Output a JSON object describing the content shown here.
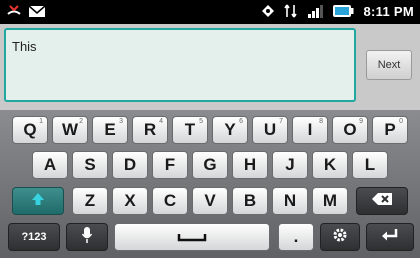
{
  "status_bar": {
    "time": "8:11 PM",
    "icons": [
      "missed-call-icon",
      "message-icon",
      "location-icon",
      "signal-icon",
      "battery-icon"
    ]
  },
  "compose": {
    "text": "This",
    "next_label": "Next"
  },
  "keyboard": {
    "row1": [
      {
        "label": "Q",
        "hint": "1"
      },
      {
        "label": "W",
        "hint": "2"
      },
      {
        "label": "E",
        "hint": "3"
      },
      {
        "label": "R",
        "hint": "4"
      },
      {
        "label": "T",
        "hint": "5"
      },
      {
        "label": "Y",
        "hint": "6"
      },
      {
        "label": "U",
        "hint": "7"
      },
      {
        "label": "I",
        "hint": "8"
      },
      {
        "label": "O",
        "hint": "9"
      },
      {
        "label": "P",
        "hint": "0"
      }
    ],
    "row2": [
      "A",
      "S",
      "D",
      "F",
      "G",
      "H",
      "J",
      "K",
      "L"
    ],
    "row3": [
      "Z",
      "X",
      "C",
      "V",
      "B",
      "N",
      "M"
    ],
    "sym_label": "?123",
    "period_label": "."
  }
}
